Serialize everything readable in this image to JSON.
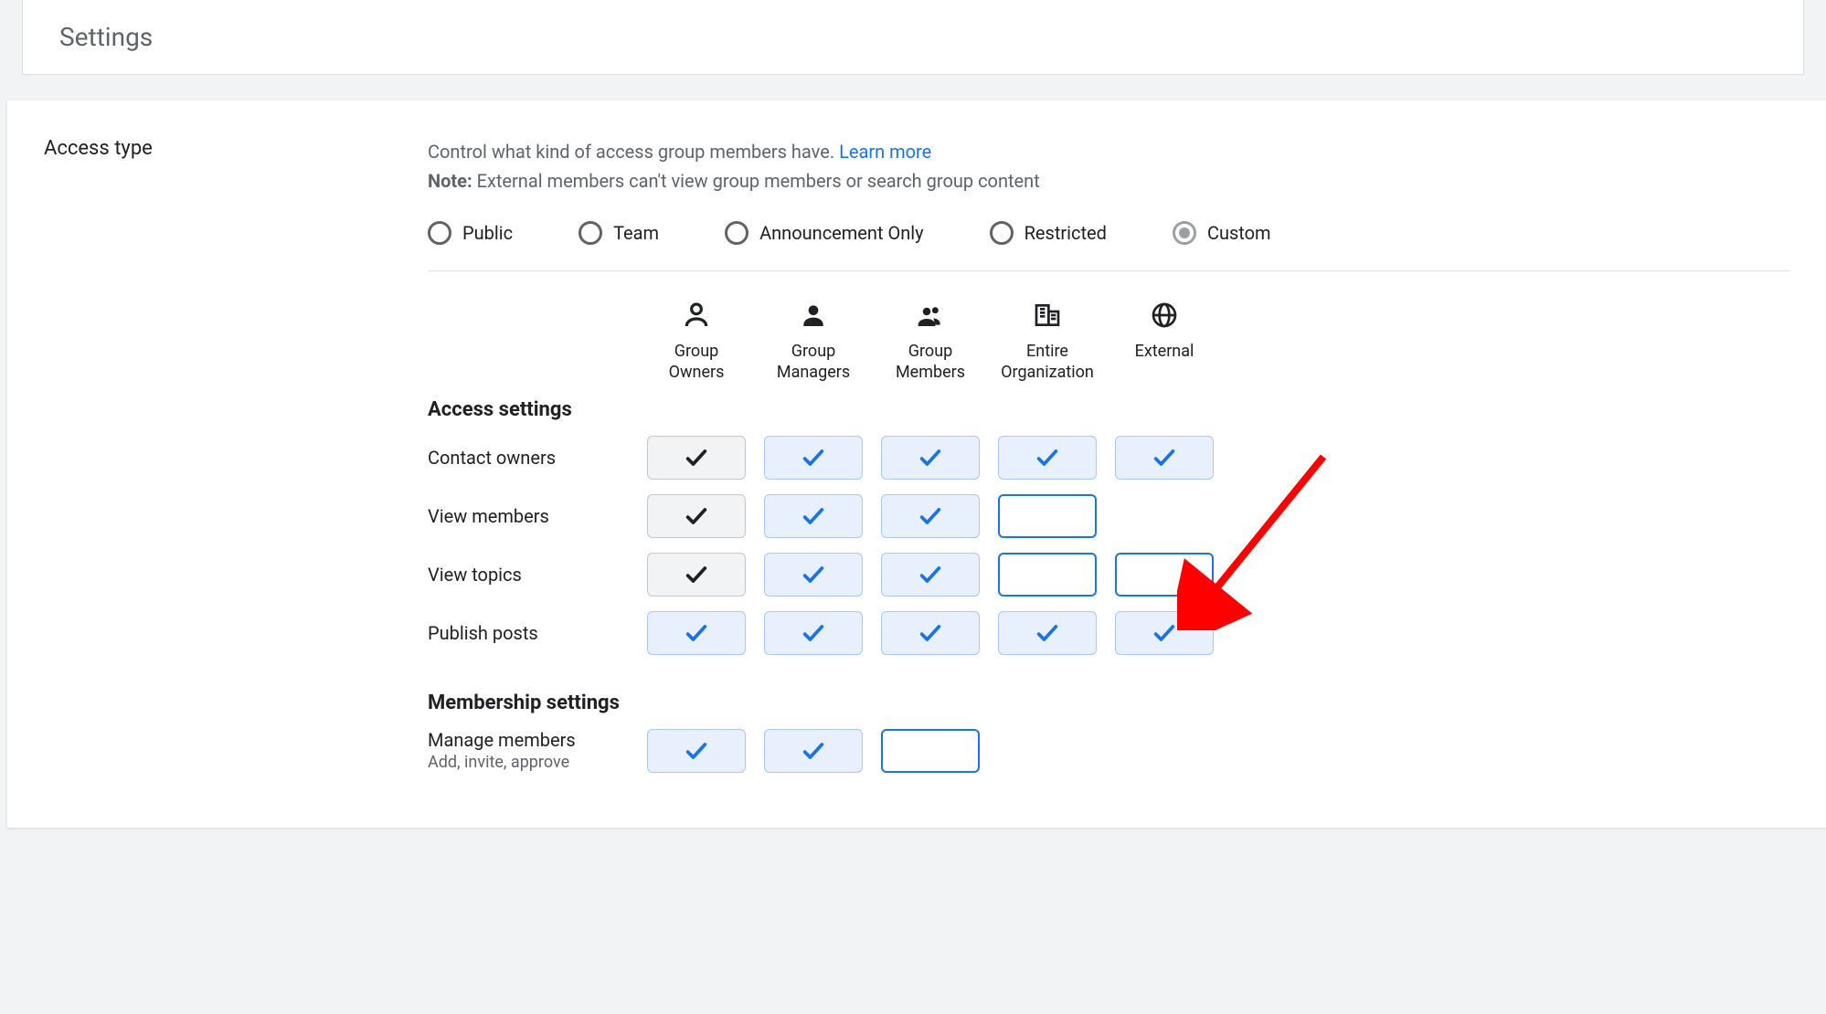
{
  "header": {
    "title": "Settings"
  },
  "side_label": "Access type",
  "help": {
    "line1": "Control what kind of access group members have.",
    "learn_more": "Learn more",
    "note_label": "Note:",
    "note_text": " External members can't view group members or search group content"
  },
  "radios": [
    {
      "id": "public",
      "label": "Public",
      "selected": false
    },
    {
      "id": "team",
      "label": "Team",
      "selected": false
    },
    {
      "id": "announcement",
      "label": "Announcement Only",
      "selected": false
    },
    {
      "id": "restricted",
      "label": "Restricted",
      "selected": false
    },
    {
      "id": "custom",
      "label": "Custom",
      "selected": true
    }
  ],
  "columns": [
    {
      "id": "owners",
      "label": "Group Owners",
      "icon": "owner"
    },
    {
      "id": "managers",
      "label": "Group Managers",
      "icon": "manager"
    },
    {
      "id": "members",
      "label": "Group Members",
      "icon": "members"
    },
    {
      "id": "org",
      "label": "Entire Organization",
      "icon": "org"
    },
    {
      "id": "external",
      "label": "External",
      "icon": "globe"
    }
  ],
  "sections": [
    {
      "title": "Access settings",
      "rows": [
        {
          "id": "contact-owners",
          "label": "Contact owners",
          "cells": [
            "locked",
            "on",
            "on",
            "on",
            "on"
          ]
        },
        {
          "id": "view-members",
          "label": "View members",
          "cells": [
            "locked",
            "on",
            "on",
            "off",
            "none"
          ]
        },
        {
          "id": "view-topics",
          "label": "View topics",
          "cells": [
            "locked",
            "on",
            "on",
            "off",
            "off"
          ]
        },
        {
          "id": "publish-posts",
          "label": "Publish posts",
          "cells": [
            "on",
            "on",
            "on",
            "on",
            "on"
          ]
        }
      ]
    },
    {
      "title": "Membership settings",
      "rows": [
        {
          "id": "manage-members",
          "label": "Manage members",
          "sublabel": "Add, invite, approve",
          "cells": [
            "on",
            "on",
            "off",
            "none",
            "none"
          ]
        }
      ]
    }
  ],
  "annotation": {
    "arrow_points_to": "publish-posts / external cell"
  }
}
